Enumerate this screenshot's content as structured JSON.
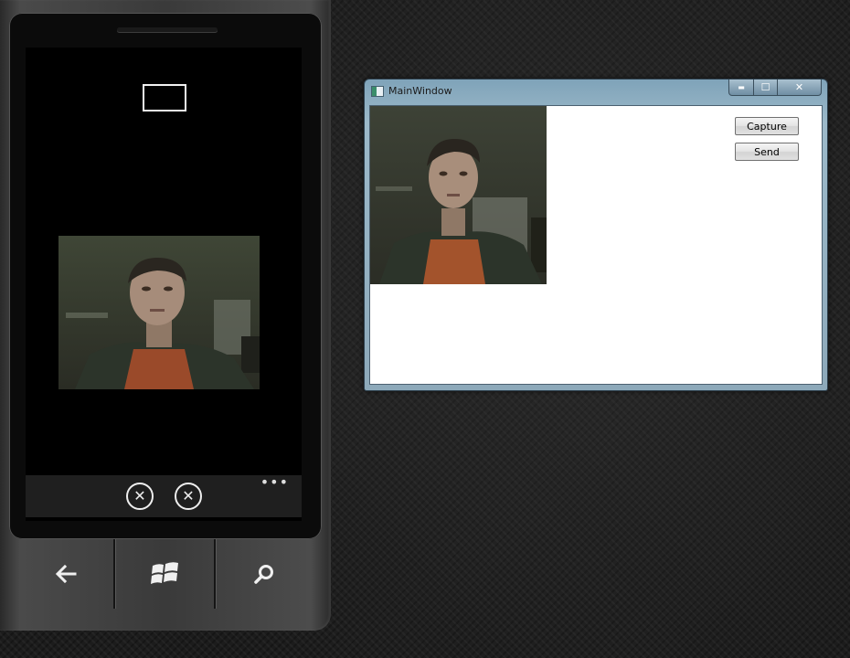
{
  "window": {
    "title": "MainWindow",
    "controls": {
      "minimize": "▬",
      "maximize": "☐",
      "close": "✕"
    },
    "buttons": {
      "capture": "Capture",
      "send": "Send"
    }
  },
  "phone": {
    "app_bar": {
      "button_1_glyph": "✕",
      "button_2_glyph": "✕",
      "more": "•••"
    },
    "hardware_buttons": [
      "back-arrow-icon",
      "windows-logo-icon",
      "search-icon"
    ]
  }
}
